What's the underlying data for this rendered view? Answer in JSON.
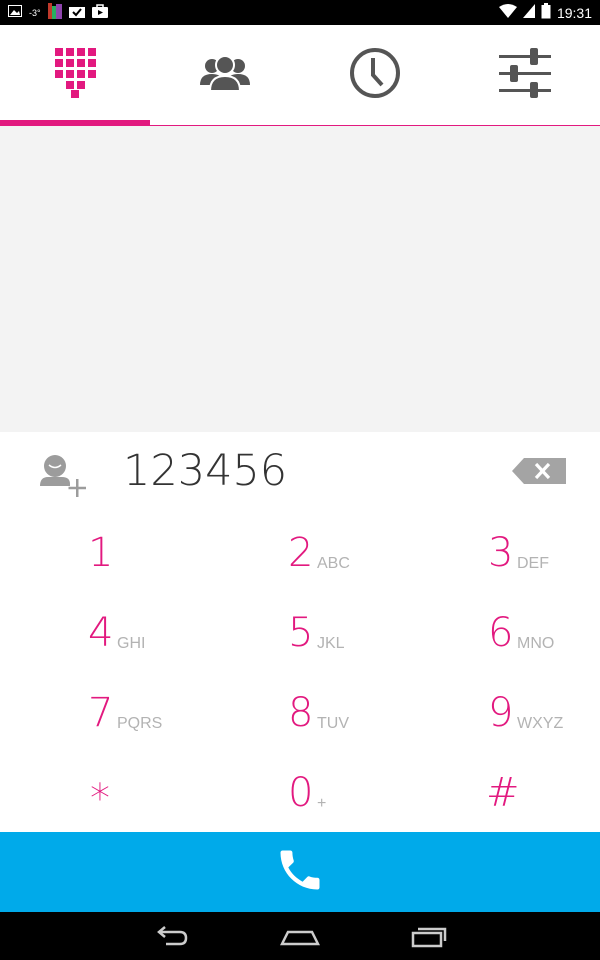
{
  "status_bar": {
    "temperature": "-3°",
    "time": "19:31"
  },
  "tabs": [
    {
      "name": "dialpad",
      "icon": "dialpad-icon",
      "active": true
    },
    {
      "name": "contacts",
      "icon": "contacts-icon",
      "active": false
    },
    {
      "name": "history",
      "icon": "clock-icon",
      "active": false
    },
    {
      "name": "settings",
      "icon": "sliders-icon",
      "active": false
    }
  ],
  "dialer": {
    "number": "123456"
  },
  "keypad": [
    {
      "digit": "1",
      "letters": ""
    },
    {
      "digit": "2",
      "letters": "ABC"
    },
    {
      "digit": "3",
      "letters": "DEF"
    },
    {
      "digit": "4",
      "letters": "GHI"
    },
    {
      "digit": "5",
      "letters": "JKL"
    },
    {
      "digit": "6",
      "letters": "MNO"
    },
    {
      "digit": "7",
      "letters": "PQRS"
    },
    {
      "digit": "8",
      "letters": "TUV"
    },
    {
      "digit": "9",
      "letters": "WXYZ"
    },
    {
      "digit": "*",
      "letters": ""
    },
    {
      "digit": "0",
      "letters": "+"
    },
    {
      "digit": "#",
      "letters": ""
    }
  ],
  "colors": {
    "accent": "#e2197f",
    "call_bar": "#00aaea",
    "content_bg": "#f3f3f3"
  }
}
